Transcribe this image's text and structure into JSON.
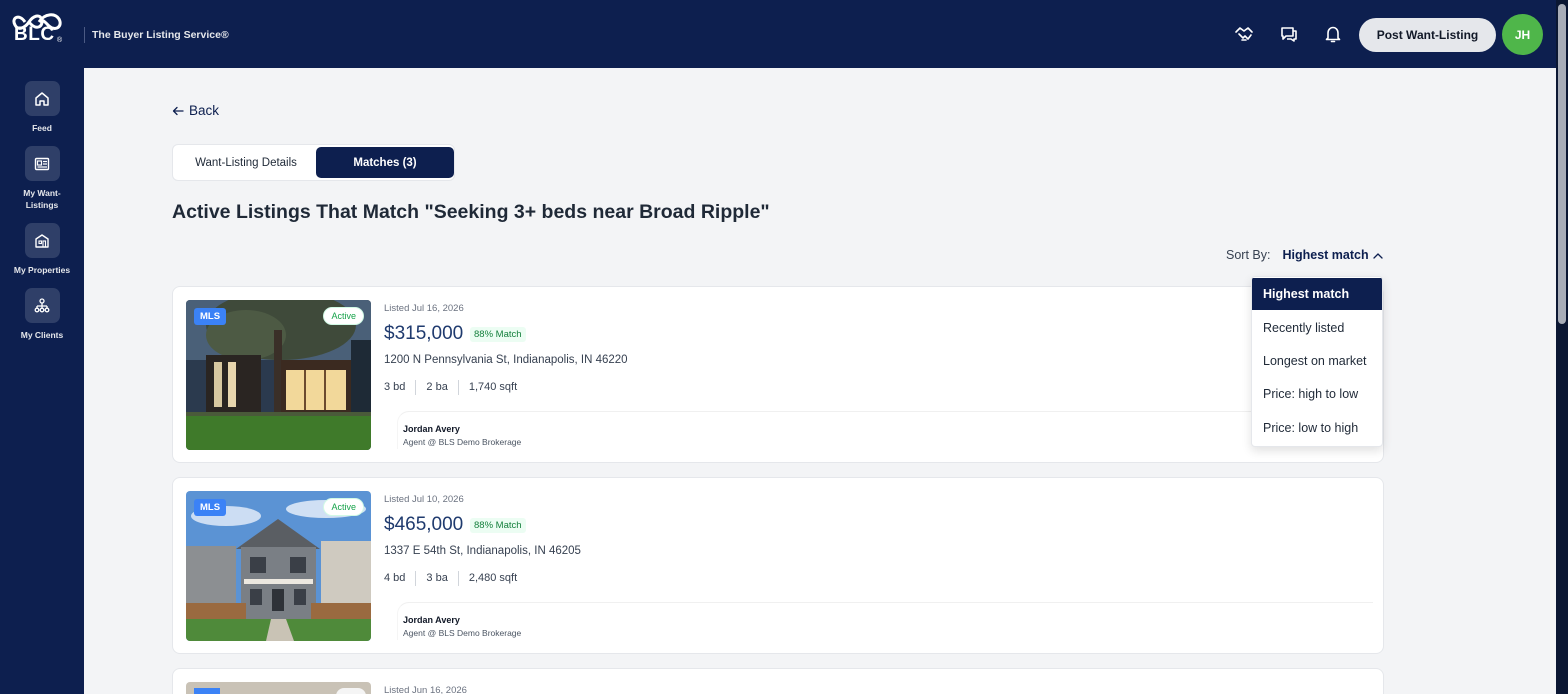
{
  "header": {
    "logo_text": "BLC",
    "logo_reg": "®",
    "tagline": "The Buyer Listing Service®",
    "post_button": "Post Want-Listing",
    "avatar_initials": "JH",
    "icons": [
      "handshake-icon",
      "chat-icon",
      "bell-icon"
    ]
  },
  "sidebar": {
    "items": [
      {
        "label": "Feed",
        "icon": "home-icon"
      },
      {
        "label": "My Want-Listings",
        "icon": "listing-card-icon"
      },
      {
        "label": "My Properties",
        "icon": "house-icon"
      },
      {
        "label": "My Clients",
        "icon": "org-chart-icon"
      }
    ]
  },
  "main": {
    "back": "Back",
    "tabs": [
      "Want-Listing Details",
      "Matches (3)"
    ],
    "active_tab": "Matches (3)",
    "title": "Active Listings That Match \"Seeking 3+ beds near Broad Ripple\"",
    "sort_label": "Sort By:",
    "sort_value": "Highest match"
  },
  "sort_options": [
    "Highest match",
    "Recently listed",
    "Longest on market",
    "Price: high to low",
    "Price: low to high"
  ],
  "listings": [
    {
      "listed": "Listed Jul 16, 2026",
      "price": "$315,000",
      "match": "88% Match",
      "address": "1200 N Pennsylvania St, Indianapolis, IN 46220",
      "beds": "3 bd",
      "baths": "2 ba",
      "sqft": "1,740 sqft",
      "badge": "MLS",
      "status": "Active",
      "agent_name": "Jordan Avery",
      "agent_org": "Agent @ BLS Demo Brokerage"
    },
    {
      "listed": "Listed Jul 10, 2026",
      "price": "$465,000",
      "match": "88% Match",
      "address": "1337 E 54th St, Indianapolis, IN 46205",
      "beds": "4 bd",
      "baths": "3 ba",
      "sqft": "2,480 sqft",
      "badge": "MLS",
      "status": "Active",
      "agent_name": "Jordan Avery",
      "agent_org": "Agent @ BLS Demo Brokerage"
    },
    {
      "listed": "Listed Jun 16, 2026"
    }
  ],
  "colors": {
    "navy": "#0d1f4f",
    "avatar_green": "#4fb64a",
    "mls_blue": "#3b82f6",
    "match_green": "#15803d"
  }
}
